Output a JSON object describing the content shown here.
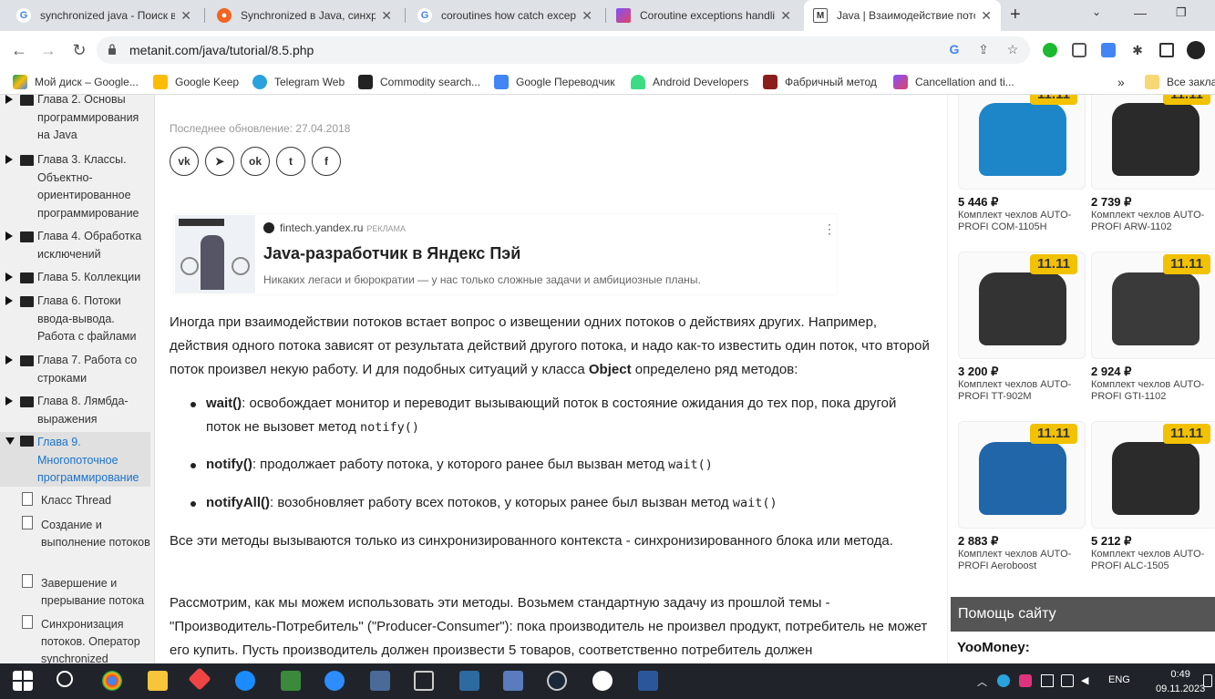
{
  "browser": {
    "tabs": [
      {
        "title": "synchronized java - Поиск в",
        "icon": "google-icon"
      },
      {
        "title": "Synchronized в Java, синхро",
        "icon": "site-icon"
      },
      {
        "title": "coroutines how catch except",
        "icon": "google-icon"
      },
      {
        "title": "Coroutine exceptions handli",
        "icon": "kotlin-icon"
      },
      {
        "title": "Java | Взаимодействие пото",
        "icon": "metanit-icon",
        "active": true
      }
    ],
    "new_tab": "+",
    "url": "metanit.com/java/tutorial/8.5.php",
    "bookmarks": [
      "Мой диск – Google...",
      "Google Keep",
      "Telegram Web",
      "Commodity search...",
      "Google Переводчик",
      "Android Developers",
      "Фабричный метод",
      "Cancellation and ti...",
      "Все заклад"
    ]
  },
  "sidebar": {
    "chapters": [
      {
        "text": "Глава 2. Основы программирования на Java"
      },
      {
        "text": "Глава 3. Классы. Объектно-ориентированное программирование"
      },
      {
        "text": "Глава 4. Обработка исключений"
      },
      {
        "text": "Глава 5. Коллекции"
      },
      {
        "text": "Глава 6. Потоки ввода-вывода. Работа с файлами"
      },
      {
        "text": "Глава 7. Работа со строками"
      },
      {
        "text": "Глава 8. Лямбда-выражения"
      },
      {
        "text": "Глава 9. Многопоточное программирование"
      }
    ],
    "subitems": [
      "Класс Thread",
      "Создание и выполнение потоков",
      "Завершение и прерывание потока",
      "Синхронизация потоков. Оператор synchronized"
    ]
  },
  "article": {
    "updated": "Последнее обновление: 27.04.2018",
    "share_icons": [
      "vk-icon",
      "telegram-icon",
      "odnoklassniki-icon",
      "twitter-icon",
      "facebook-icon"
    ],
    "ad": {
      "source": "fintech.yandex.ru",
      "tag": "РЕКЛАМА",
      "title": "Java-разработчик в Яндекс Пэй",
      "desc": "Никаких легаси и бюрократии — у нас только сложные задачи и амбициозные планы."
    },
    "intro_1": "Иногда при взаимодействии потоков встает вопрос о извещении одних потоков о действиях других. Например, действия одного потока зависят от результата действий другого потока, и надо как-то известить один поток, что второй поток произвел некую работу. И для подобных ситуаций у класса ",
    "intro_bold": "Object",
    "intro_2": " определено ряд методов:",
    "methods": [
      {
        "name": "wait()",
        "desc": ": освобождает монитор и переводит вызывающий поток в состояние ожидания до тех пор, пока другой поток не вызовет метод ",
        "code": "notify()"
      },
      {
        "name": "notify()",
        "desc": ": продолжает работу потока, у которого ранее был вызван метод ",
        "code": "wait()"
      },
      {
        "name": "notifyAll()",
        "desc": ": возобновляет работу всех потоков, у которых ранее был вызван метод ",
        "code": "wait()"
      }
    ],
    "para2": "Все эти методы вызываются только из синхронизированного контекста - синхронизированного блока или метода.",
    "para3": "Рассмотрим, как мы можем использовать эти методы. Возьмем стандартную задачу из прошлой темы - \"Производитель-Потребитель\" (\"Producer-Consumer\"): пока производитель не произвел продукт, потребитель не может его купить. Пусть производитель должен произвести 5 товаров, соответственно потребитель должен"
  },
  "products": [
    {
      "price": "5 446 ₽",
      "name": "Комплект чехлов AUTO-PROFI COM-1105H",
      "badge": "11.11",
      "color": "#1d86c8"
    },
    {
      "price": "2 739 ₽",
      "name": "Комплект чехлов AUTO-PROFI ARW-1102",
      "badge": "11.11",
      "color": "#2a2a2a"
    },
    {
      "price": "3 200 ₽",
      "name": "Комплект чехлов AUTO-PROFI TT-902M",
      "badge": "11.11",
      "color": "#333333"
    },
    {
      "price": "2 924 ₽",
      "name": "Комплект чехлов AUTO-PROFI GTI-1102",
      "badge": "11.11",
      "color": "#3a3a3a"
    },
    {
      "price": "2 883 ₽",
      "name": "Комплект чехлов AUTO-PROFI Aeroboost",
      "badge": "11.11",
      "color": "#2266aa"
    },
    {
      "price": "5 212 ₽",
      "name": "Комплект чехлов AUTO-PROFI ALC-1505",
      "badge": "11.11",
      "color": "#2b2b2b"
    }
  ],
  "help": {
    "title": "Помощь сайту",
    "yoomoney": "YooMoney:"
  },
  "taskbar": {
    "lang": "ENG",
    "time": "0:49",
    "date": "09.11.2023"
  }
}
